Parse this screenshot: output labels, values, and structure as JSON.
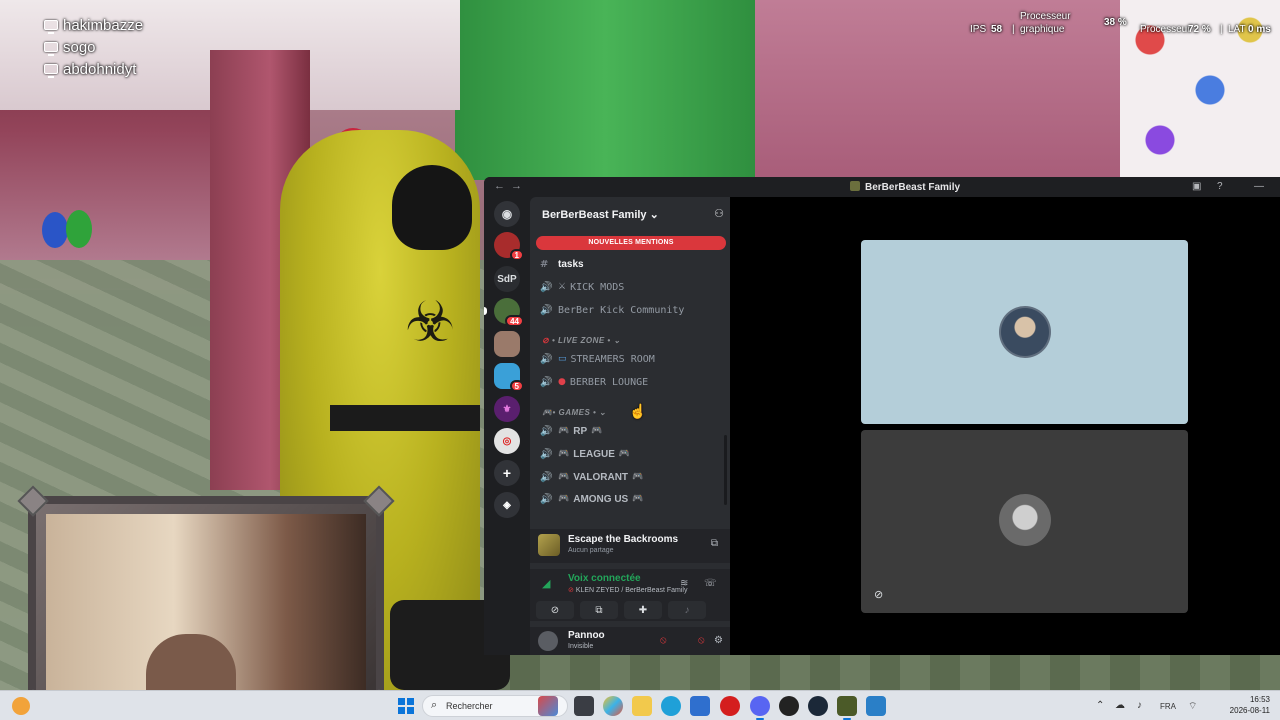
{
  "overlay": {
    "viewers": [
      "hakimbazze",
      "sogo",
      "abdohnidyt"
    ],
    "perf": {
      "ips_label": "IPS",
      "ips_value": "58",
      "gpu_label_1": "Processeur",
      "gpu_label_2": "graphique",
      "gpu_value": "38 %",
      "cpu_label": "Processeur",
      "cpu_value": "72 %",
      "lat_label": "LAT",
      "lat_value": "0 ms"
    }
  },
  "discord": {
    "window_title": "BerBerBeast Family",
    "server_name": "BerBerBeast Family",
    "mentions_banner": "NOUVELLES MENTIONS",
    "rail": {
      "server_abbrev": "SdP",
      "badges": [
        "1",
        "44",
        "5"
      ]
    },
    "channels": {
      "tasks": "tasks",
      "kick_mods": "KICK MODS",
      "community": "BerBer Kick Community",
      "live_zone": "• LIVE ZONE •",
      "streamers_room": "STREAMERS ROOM",
      "berber_lounge": "BERBER LOUNGE",
      "games": "• GAMES •",
      "rp": "RP",
      "league": "LEAGUE",
      "valorant": "VALORANT",
      "among_us": "AMONG US"
    },
    "activity": {
      "title": "Escape the Backrooms",
      "subtitle": "Aucun partage"
    },
    "voice": {
      "status": "Voix connectée",
      "channel": "KLEN ZEYED / BerBerBeast Family"
    },
    "user": {
      "name": "Pannoo",
      "status": "Invisible"
    }
  },
  "taskbar": {
    "search_placeholder": "Rechercher",
    "language": "FRA",
    "time": "16:53",
    "date": "2026-08-11"
  },
  "colors": {
    "discord_bg": "#1e1f22",
    "sidebar_bg": "#2b2d31",
    "mention_red": "#da373c",
    "voice_green": "#23a55a",
    "tile_blue": "#b4ced9"
  }
}
